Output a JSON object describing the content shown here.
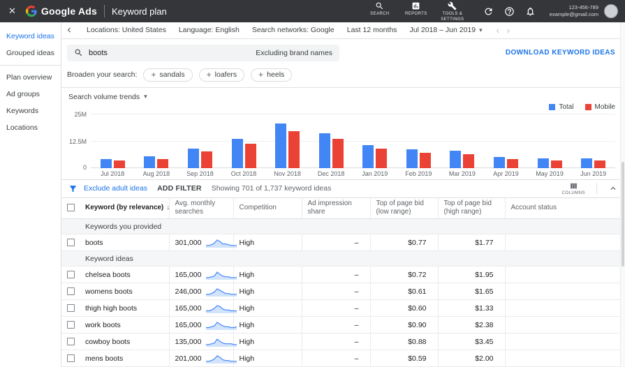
{
  "icons": {
    "close": "✕",
    "caret_down": "▾",
    "chevron_left": "‹",
    "chevron_right": "›",
    "sort_desc": "↓",
    "plus": "+"
  },
  "topbar": {
    "brand": "Google Ads",
    "page_title": "Keyword plan",
    "nav_items": [
      {
        "label": "SEARCH"
      },
      {
        "label": "REPORTS"
      },
      {
        "label": "TOOLS & SETTINGS"
      }
    ],
    "account": {
      "id": "123-456-789",
      "email": "example@gmail.com"
    }
  },
  "sidebar": {
    "items": [
      {
        "label": "Keyword ideas",
        "active": true
      },
      {
        "label": "Grouped ideas",
        "active": false
      },
      {
        "label": "Plan overview",
        "active": false
      },
      {
        "label": "Ad groups",
        "active": false
      },
      {
        "label": "Keywords",
        "active": false
      },
      {
        "label": "Locations",
        "active": false
      }
    ]
  },
  "settings_bar": {
    "locations": "Locations: United States",
    "language": "Language: English",
    "networks": "Search networks: Google",
    "period": "Last 12 months",
    "date_range": "Jul 2018 – Jun 2019"
  },
  "search": {
    "query": "boots",
    "exclusion_note": "Excluding brand names",
    "download_label": "DOWNLOAD KEYWORD IDEAS"
  },
  "broaden": {
    "label": "Broaden your search:",
    "chips": [
      {
        "label": "sandals"
      },
      {
        "label": "loafers"
      },
      {
        "label": "heels"
      }
    ]
  },
  "chart_data": {
    "type": "bar",
    "title": "Search volume trends",
    "categories": [
      "Jul 2018",
      "Aug 2018",
      "Sep 2018",
      "Oct 2018",
      "Nov 2018",
      "Dec 2018",
      "Jan 2019",
      "Feb 2019",
      "Mar 2019",
      "Apr 2019",
      "May 2019",
      "Jun 2019"
    ],
    "series": [
      {
        "name": "Total",
        "color": "#4285f4",
        "values": [
          4.0,
          5.5,
          9.0,
          13.5,
          20.5,
          16.0,
          10.5,
          8.5,
          8.0,
          5.0,
          4.5,
          4.5
        ]
      },
      {
        "name": "Mobile",
        "color": "#ea4335",
        "values": [
          3.5,
          4.0,
          7.5,
          11.0,
          17.0,
          13.5,
          9.0,
          7.0,
          6.5,
          4.0,
          3.5,
          3.5
        ]
      }
    ],
    "unit": "M",
    "yticks": [
      "25M",
      "12.5M",
      "0"
    ],
    "ylim": [
      0,
      25
    ],
    "legend_position": "top-right",
    "grid": true
  },
  "filter_bar": {
    "exclude_label": "Exclude adult ideas",
    "add_filter_label": "ADD FILTER",
    "showing_text": "Showing 701 of 1,737 keyword ideas",
    "columns_label": "COLUMNS"
  },
  "table": {
    "headers": {
      "keyword": "Keyword (by relevance)",
      "avg_searches": "Avg. monthly searches",
      "competition": "Competition",
      "ad_impression": "Ad impression share",
      "bid_low": "Top of page bid (low range)",
      "bid_high": "Top of page bid (high range)",
      "account_status": "Account status"
    },
    "sections": {
      "provided": "Keywords you provided",
      "ideas": "Keyword ideas"
    },
    "provided_rows": [
      {
        "keyword": "boots",
        "searches": "301,000",
        "competition": "High",
        "impression": "–",
        "low": "$0.77",
        "high": "$1.77",
        "status": "",
        "spark": [
          2,
          2,
          3,
          5,
          9,
          7,
          4,
          4,
          3,
          2,
          2,
          2
        ]
      }
    ],
    "idea_rows": [
      {
        "keyword": "chelsea boots",
        "searches": "165,000",
        "competition": "High",
        "impression": "–",
        "low": "$0.72",
        "high": "$1.95",
        "status": "",
        "spark": [
          2,
          2,
          3,
          4,
          9,
          6,
          4,
          3,
          3,
          2,
          2,
          2
        ]
      },
      {
        "keyword": "womens boots",
        "searches": "246,000",
        "competition": "High",
        "impression": "–",
        "low": "$0.61",
        "high": "$1.65",
        "status": "",
        "spark": [
          2,
          2,
          3,
          5,
          9,
          7,
          5,
          3,
          3,
          2,
          2,
          2
        ]
      },
      {
        "keyword": "thigh high boots",
        "searches": "165,000",
        "competition": "High",
        "impression": "–",
        "low": "$0.60",
        "high": "$1.33",
        "status": "",
        "spark": [
          2,
          2,
          3,
          5,
          8,
          7,
          4,
          3,
          3,
          2,
          2,
          2
        ]
      },
      {
        "keyword": "work boots",
        "searches": "165,000",
        "competition": "High",
        "impression": "–",
        "low": "$0.90",
        "high": "$2.38",
        "status": "",
        "spark": [
          2,
          2,
          3,
          4,
          8,
          6,
          4,
          3,
          3,
          2,
          2,
          3
        ]
      },
      {
        "keyword": "cowboy boots",
        "searches": "135,000",
        "competition": "High",
        "impression": "–",
        "low": "$0.88",
        "high": "$3.45",
        "status": "",
        "spark": [
          2,
          2,
          3,
          4,
          9,
          6,
          4,
          3,
          3,
          3,
          2,
          2
        ]
      },
      {
        "keyword": "mens boots",
        "searches": "201,000",
        "competition": "High",
        "impression": "–",
        "low": "$0.59",
        "high": "$2.00",
        "status": "",
        "spark": [
          2,
          2,
          3,
          5,
          9,
          7,
          4,
          3,
          3,
          2,
          2,
          2
        ]
      }
    ]
  }
}
